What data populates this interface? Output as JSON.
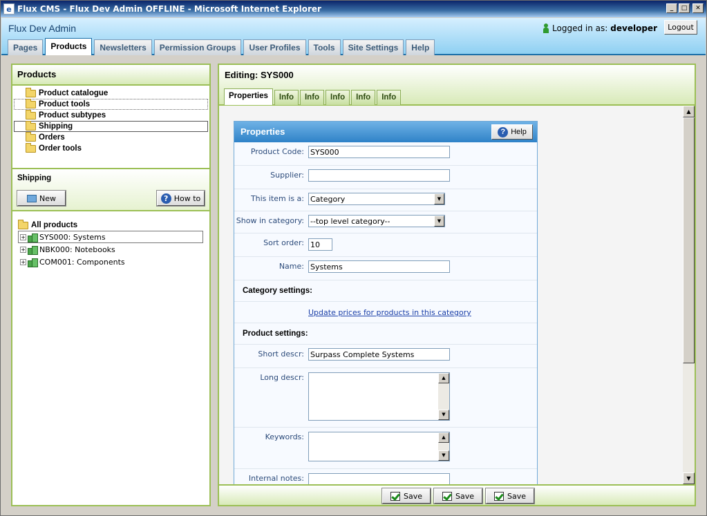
{
  "window": {
    "title": "Flux CMS - Flux Dev Admin OFFLINE - Microsoft Internet Explorer"
  },
  "header": {
    "app_title": "Flux Dev Admin",
    "logged_in_label": "Logged in as:",
    "username": "developer",
    "logout_label": "Logout",
    "tabs": [
      "Pages",
      "Products",
      "Newsletters",
      "Permission Groups",
      "User Profiles",
      "Tools",
      "Site Settings",
      "Help"
    ],
    "active_tab": "Products"
  },
  "left": {
    "title": "Products",
    "categories": [
      "Product catalogue",
      "Product tools",
      "Product subtypes",
      "Shipping",
      "Orders",
      "Order tools"
    ],
    "selected_category": "Shipping",
    "focused_category": "Product tools",
    "section_title": "Shipping",
    "new_label": "New",
    "howto_label": "How to",
    "tree_root": "All products",
    "tree_items": [
      "SYS000: Systems",
      "NBK000: Notebooks",
      "COM001: Components"
    ],
    "selected_tree_item": "SYS000: Systems"
  },
  "right": {
    "editing_title": "Editing: SYS000",
    "tabs": [
      "Properties",
      "Info",
      "Info",
      "Info",
      "Info",
      "Info"
    ],
    "active_tab": "Properties",
    "properties": {
      "title": "Properties",
      "help_label": "Help",
      "product_code_label": "Product Code:",
      "product_code_value": "SYS000",
      "supplier_label": "Supplier:",
      "supplier_value": "",
      "item_type_label": "This item is a:",
      "item_type_value": "Category",
      "show_in_label": "Show in category:",
      "show_in_value": "--top level category--",
      "sort_order_label": "Sort order:",
      "sort_order_value": "10",
      "name_label": "Name:",
      "name_value": "Systems",
      "category_settings_heading": "Category settings:",
      "update_prices_link": "Update prices for products in this category",
      "product_settings_heading": "Product settings:",
      "short_descr_label": "Short descr:",
      "short_descr_value": "Surpass Complete Systems",
      "long_descr_label": "Long descr:",
      "keywords_label": "Keywords:",
      "internal_notes_label": "Internal notes:"
    },
    "save_label": "Save"
  }
}
